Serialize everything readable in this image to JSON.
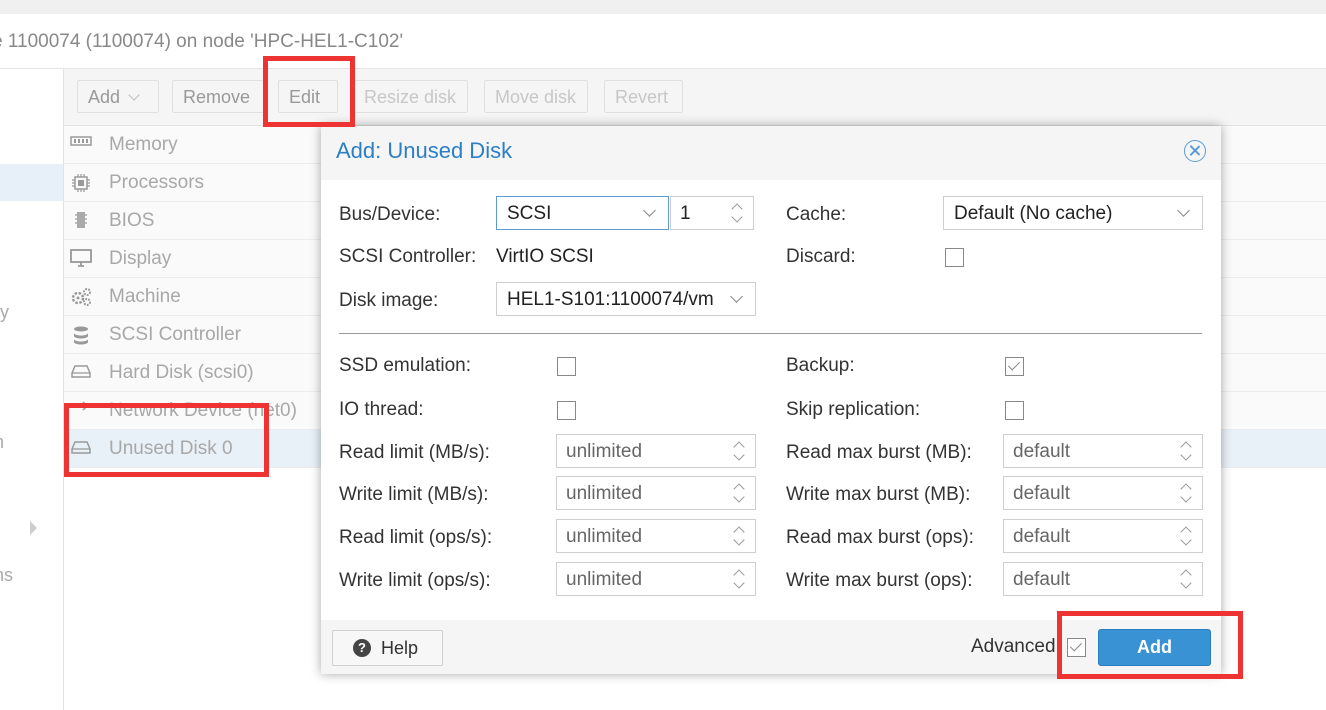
{
  "header": {
    "title": "e 1100074 (1100074) on node 'HPC-HEL1-C102'"
  },
  "leftnav": {
    "fragments": [
      "ry",
      "n",
      "ns"
    ]
  },
  "toolbar": {
    "add": "Add",
    "remove": "Remove",
    "edit": "Edit",
    "resize_disk": "Resize disk",
    "move_disk": "Move disk",
    "revert": "Revert"
  },
  "hardware": [
    {
      "label": "Memory",
      "icon": "memory-icon"
    },
    {
      "label": "Processors",
      "icon": "cpu-icon"
    },
    {
      "label": "BIOS",
      "icon": "bios-icon"
    },
    {
      "label": "Display",
      "icon": "monitor-icon"
    },
    {
      "label": "Machine",
      "icon": "gears-icon"
    },
    {
      "label": "SCSI Controller",
      "icon": "database-icon"
    },
    {
      "label": "Hard Disk (scsi0)",
      "icon": "hdd-icon"
    },
    {
      "label": "Network Device (net0)",
      "icon": "network-icon"
    },
    {
      "label": "Unused Disk 0",
      "icon": "hdd-icon",
      "selected": true
    }
  ],
  "dialog": {
    "title": "Add: Unused Disk",
    "bus_device": {
      "label": "Bus/Device:",
      "bus": "SCSI",
      "device": "1"
    },
    "scsi_controller": {
      "label": "SCSI Controller:",
      "value": "VirtIO SCSI"
    },
    "disk_image": {
      "label": "Disk image:",
      "value": "HEL1-S101:1100074/vm"
    },
    "cache": {
      "label": "Cache:",
      "value": "Default (No cache)"
    },
    "discard": {
      "label": "Discard:",
      "checked": false
    },
    "ssd_emulation": {
      "label": "SSD emulation:",
      "checked": false
    },
    "io_thread": {
      "label": "IO thread:",
      "checked": false
    },
    "backup": {
      "label": "Backup:",
      "checked": true
    },
    "skip_replication": {
      "label": "Skip replication:",
      "checked": false
    },
    "read_limit_mb": {
      "label": "Read limit (MB/s):",
      "value": "unlimited"
    },
    "write_limit_mb": {
      "label": "Write limit (MB/s):",
      "value": "unlimited"
    },
    "read_limit_ops": {
      "label": "Read limit (ops/s):",
      "value": "unlimited"
    },
    "write_limit_ops": {
      "label": "Write limit (ops/s):",
      "value": "unlimited"
    },
    "read_burst_mb": {
      "label": "Read max burst (MB):",
      "value": "default"
    },
    "write_burst_mb": {
      "label": "Write max burst (MB):",
      "value": "default"
    },
    "read_burst_ops": {
      "label": "Read max burst (ops):",
      "value": "default"
    },
    "write_burst_ops": {
      "label": "Write max burst (ops):",
      "value": "default"
    },
    "footer": {
      "help": "Help",
      "help_glyph": "?",
      "advanced": "Advanced",
      "advanced_checked": true,
      "add": "Add"
    }
  },
  "colors": {
    "accent": "#3892d4",
    "title": "#2b7fc7",
    "highlight": "#ee3333",
    "selected_row": "#e8f0f8"
  }
}
